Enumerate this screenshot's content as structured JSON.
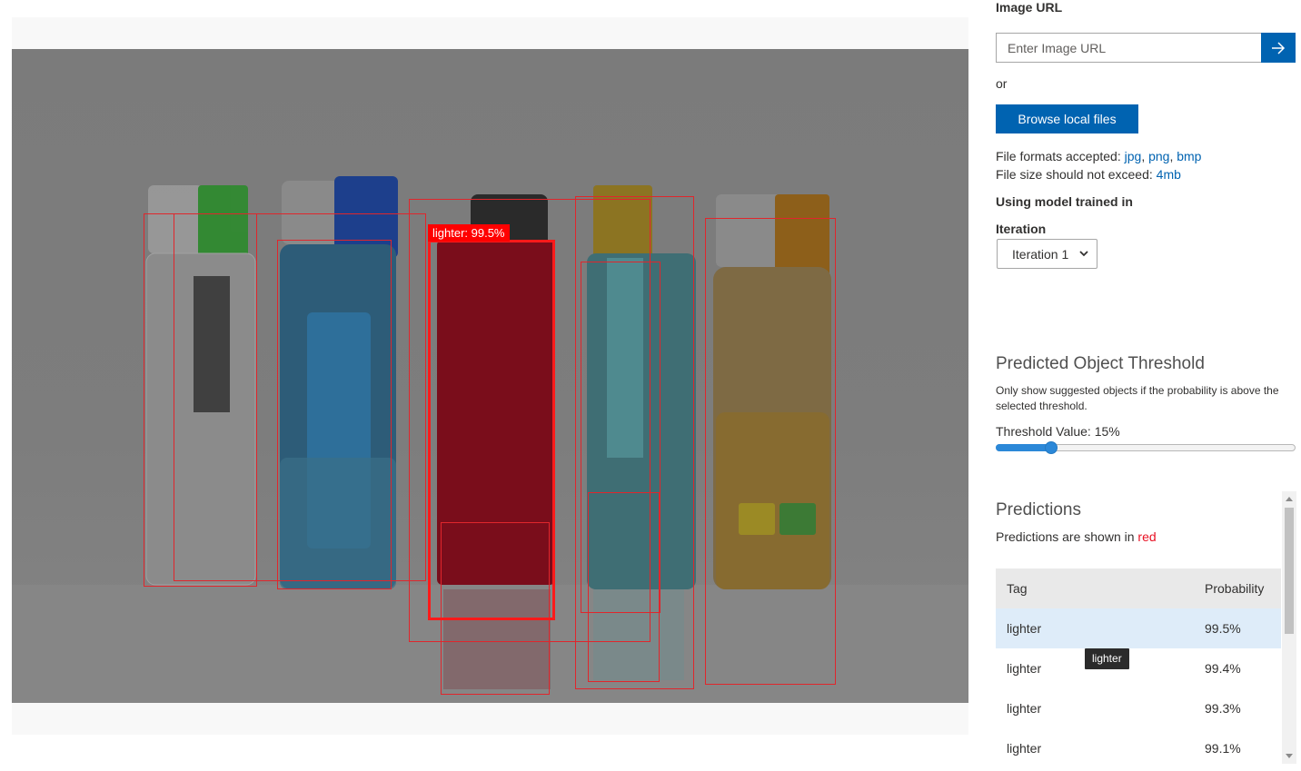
{
  "image_url": {
    "label": "Image URL",
    "placeholder": "Enter Image URL",
    "go_icon": "arrow-right-icon"
  },
  "or_text": "or",
  "browse_label": "Browse local files",
  "file_info": {
    "formats_prefix": "File formats accepted:",
    "formats": [
      "jpg",
      "png",
      "bmp"
    ],
    "size_prefix": "File size should not exceed:",
    "size": "4mb"
  },
  "model": {
    "trained_label": "Using model trained in",
    "iteration_label": "Iteration",
    "iteration_value": "Iteration 1"
  },
  "threshold": {
    "title": "Predicted Object Threshold",
    "description": "Only show suggested objects if the probability is above the selected threshold.",
    "value_label": "Threshold Value: 15%",
    "value_percent": 15
  },
  "predictions": {
    "title": "Predictions",
    "subtitle_prefix": "Predictions are shown in",
    "subtitle_color_word": "red",
    "columns": [
      "Tag",
      "Probability"
    ],
    "rows": [
      {
        "tag": "lighter",
        "probability": "99.5%"
      },
      {
        "tag": "lighter",
        "probability": "99.4%"
      },
      {
        "tag": "lighter",
        "probability": "99.3%"
      },
      {
        "tag": "lighter",
        "probability": "99.1%"
      }
    ],
    "tooltip": "lighter"
  },
  "selected_box_label": "lighter: 99.5%",
  "colors": {
    "accent": "#0063b1",
    "box": "#e0262c",
    "highlight_row": "#deecf9",
    "slider": "#2b88d8"
  }
}
